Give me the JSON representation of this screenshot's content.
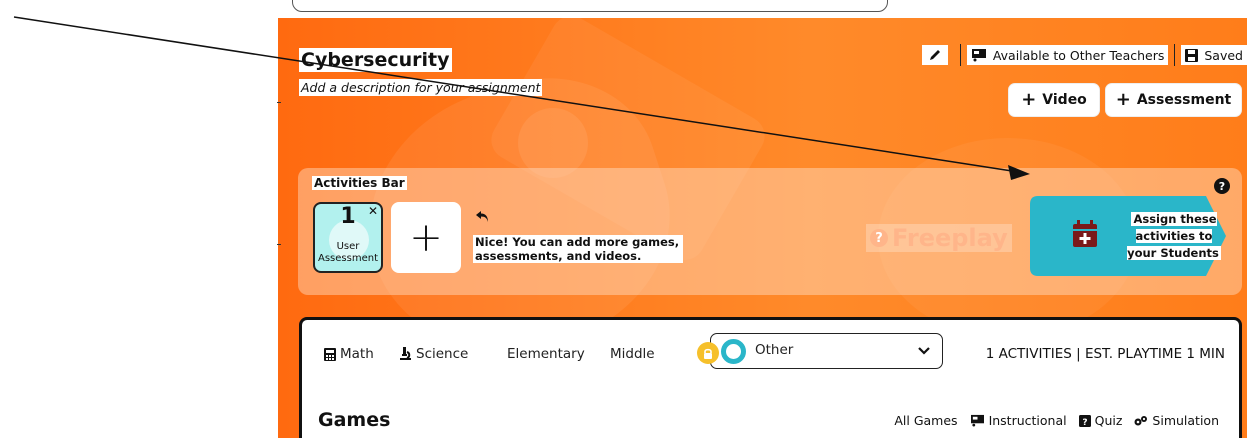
{
  "assignment": {
    "title": "Cybersecurity",
    "description": "Add a description for your assignment"
  },
  "header_actions": {
    "edit_icon": "pencil-icon",
    "availability_label": "Available to Other Teachers",
    "saved_label": "Saved"
  },
  "add_buttons": {
    "video_label": "Video",
    "assessment_label": "Assessment"
  },
  "activities_bar": {
    "label": "Activities Bar",
    "help_icon": "question-circle-icon",
    "items": [
      {
        "count": "1",
        "label": "User Assessment"
      }
    ],
    "hint_text": "Nice! You can add more games, assessments, and videos.",
    "freeplay_label": "Freeplay",
    "assign_label": "Assign these activities to your Students"
  },
  "filters": {
    "subjects": [
      "Math",
      "Science"
    ],
    "levels": [
      "Elementary",
      "Middle"
    ],
    "selected_category": "Other",
    "summary": "1 ACTIVITIES | EST. PLAYTIME 1 MIN"
  },
  "games_section": {
    "heading": "Games",
    "tabs": [
      "All Games",
      "Instructional",
      "Quiz",
      "Simulation"
    ]
  },
  "colors": {
    "hero_orange": "#ff7a1c",
    "assign_blue": "#2ab6c9",
    "card_teal": "#b2f1ee"
  }
}
